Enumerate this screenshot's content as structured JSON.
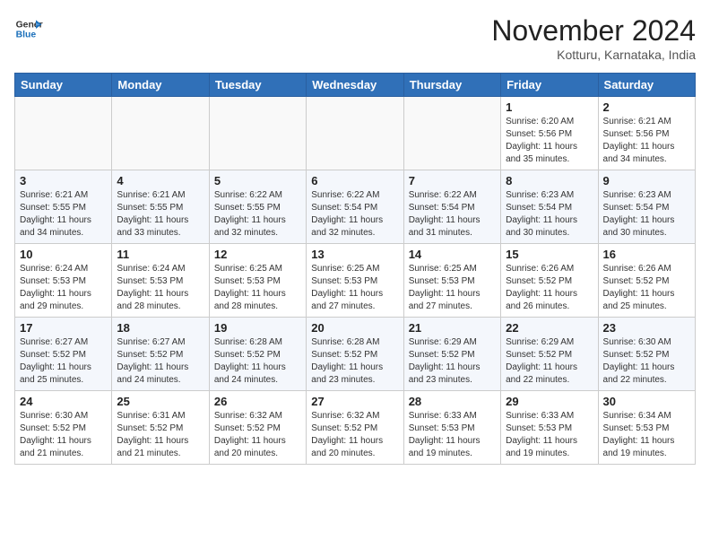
{
  "header": {
    "logo_line1": "General",
    "logo_line2": "Blue",
    "month_title": "November 2024",
    "location": "Kotturu, Karnataka, India"
  },
  "calendar": {
    "days_of_week": [
      "Sunday",
      "Monday",
      "Tuesday",
      "Wednesday",
      "Thursday",
      "Friday",
      "Saturday"
    ],
    "weeks": [
      [
        {
          "day": "",
          "info": ""
        },
        {
          "day": "",
          "info": ""
        },
        {
          "day": "",
          "info": ""
        },
        {
          "day": "",
          "info": ""
        },
        {
          "day": "",
          "info": ""
        },
        {
          "day": "1",
          "info": "Sunrise: 6:20 AM\nSunset: 5:56 PM\nDaylight: 11 hours\nand 35 minutes."
        },
        {
          "day": "2",
          "info": "Sunrise: 6:21 AM\nSunset: 5:56 PM\nDaylight: 11 hours\nand 34 minutes."
        }
      ],
      [
        {
          "day": "3",
          "info": "Sunrise: 6:21 AM\nSunset: 5:55 PM\nDaylight: 11 hours\nand 34 minutes."
        },
        {
          "day": "4",
          "info": "Sunrise: 6:21 AM\nSunset: 5:55 PM\nDaylight: 11 hours\nand 33 minutes."
        },
        {
          "day": "5",
          "info": "Sunrise: 6:22 AM\nSunset: 5:55 PM\nDaylight: 11 hours\nand 32 minutes."
        },
        {
          "day": "6",
          "info": "Sunrise: 6:22 AM\nSunset: 5:54 PM\nDaylight: 11 hours\nand 32 minutes."
        },
        {
          "day": "7",
          "info": "Sunrise: 6:22 AM\nSunset: 5:54 PM\nDaylight: 11 hours\nand 31 minutes."
        },
        {
          "day": "8",
          "info": "Sunrise: 6:23 AM\nSunset: 5:54 PM\nDaylight: 11 hours\nand 30 minutes."
        },
        {
          "day": "9",
          "info": "Sunrise: 6:23 AM\nSunset: 5:54 PM\nDaylight: 11 hours\nand 30 minutes."
        }
      ],
      [
        {
          "day": "10",
          "info": "Sunrise: 6:24 AM\nSunset: 5:53 PM\nDaylight: 11 hours\nand 29 minutes."
        },
        {
          "day": "11",
          "info": "Sunrise: 6:24 AM\nSunset: 5:53 PM\nDaylight: 11 hours\nand 28 minutes."
        },
        {
          "day": "12",
          "info": "Sunrise: 6:25 AM\nSunset: 5:53 PM\nDaylight: 11 hours\nand 28 minutes."
        },
        {
          "day": "13",
          "info": "Sunrise: 6:25 AM\nSunset: 5:53 PM\nDaylight: 11 hours\nand 27 minutes."
        },
        {
          "day": "14",
          "info": "Sunrise: 6:25 AM\nSunset: 5:53 PM\nDaylight: 11 hours\nand 27 minutes."
        },
        {
          "day": "15",
          "info": "Sunrise: 6:26 AM\nSunset: 5:52 PM\nDaylight: 11 hours\nand 26 minutes."
        },
        {
          "day": "16",
          "info": "Sunrise: 6:26 AM\nSunset: 5:52 PM\nDaylight: 11 hours\nand 25 minutes."
        }
      ],
      [
        {
          "day": "17",
          "info": "Sunrise: 6:27 AM\nSunset: 5:52 PM\nDaylight: 11 hours\nand 25 minutes."
        },
        {
          "day": "18",
          "info": "Sunrise: 6:27 AM\nSunset: 5:52 PM\nDaylight: 11 hours\nand 24 minutes."
        },
        {
          "day": "19",
          "info": "Sunrise: 6:28 AM\nSunset: 5:52 PM\nDaylight: 11 hours\nand 24 minutes."
        },
        {
          "day": "20",
          "info": "Sunrise: 6:28 AM\nSunset: 5:52 PM\nDaylight: 11 hours\nand 23 minutes."
        },
        {
          "day": "21",
          "info": "Sunrise: 6:29 AM\nSunset: 5:52 PM\nDaylight: 11 hours\nand 23 minutes."
        },
        {
          "day": "22",
          "info": "Sunrise: 6:29 AM\nSunset: 5:52 PM\nDaylight: 11 hours\nand 22 minutes."
        },
        {
          "day": "23",
          "info": "Sunrise: 6:30 AM\nSunset: 5:52 PM\nDaylight: 11 hours\nand 22 minutes."
        }
      ],
      [
        {
          "day": "24",
          "info": "Sunrise: 6:30 AM\nSunset: 5:52 PM\nDaylight: 11 hours\nand 21 minutes."
        },
        {
          "day": "25",
          "info": "Sunrise: 6:31 AM\nSunset: 5:52 PM\nDaylight: 11 hours\nand 21 minutes."
        },
        {
          "day": "26",
          "info": "Sunrise: 6:32 AM\nSunset: 5:52 PM\nDaylight: 11 hours\nand 20 minutes."
        },
        {
          "day": "27",
          "info": "Sunrise: 6:32 AM\nSunset: 5:52 PM\nDaylight: 11 hours\nand 20 minutes."
        },
        {
          "day": "28",
          "info": "Sunrise: 6:33 AM\nSunset: 5:53 PM\nDaylight: 11 hours\nand 19 minutes."
        },
        {
          "day": "29",
          "info": "Sunrise: 6:33 AM\nSunset: 5:53 PM\nDaylight: 11 hours\nand 19 minutes."
        },
        {
          "day": "30",
          "info": "Sunrise: 6:34 AM\nSunset: 5:53 PM\nDaylight: 11 hours\nand 19 minutes."
        }
      ]
    ]
  }
}
